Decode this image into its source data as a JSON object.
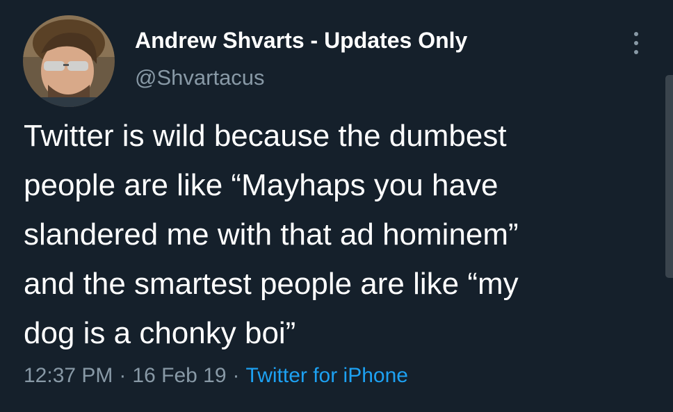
{
  "author": {
    "name": "Andrew Shvarts - Updates Only",
    "handle": "@Shvartacus",
    "avatar_icon": "profile-photo"
  },
  "tweet": {
    "lines": [
      "Twitter is wild because the dumbest",
      "people are like “Mayhaps you have",
      "slandered me with that ad hominem”",
      "and the smartest people are like “my",
      "dog is a chonky boi”"
    ]
  },
  "meta": {
    "time": "12:37 PM",
    "separator": "·",
    "date": "16 Feb 19",
    "source": "Twitter for iPhone"
  },
  "colors": {
    "background": "#15202b",
    "text": "#ffffff",
    "secondary": "#8899a6",
    "link": "#1da1f2"
  },
  "icons": {
    "more": "more-vertical-icon"
  }
}
